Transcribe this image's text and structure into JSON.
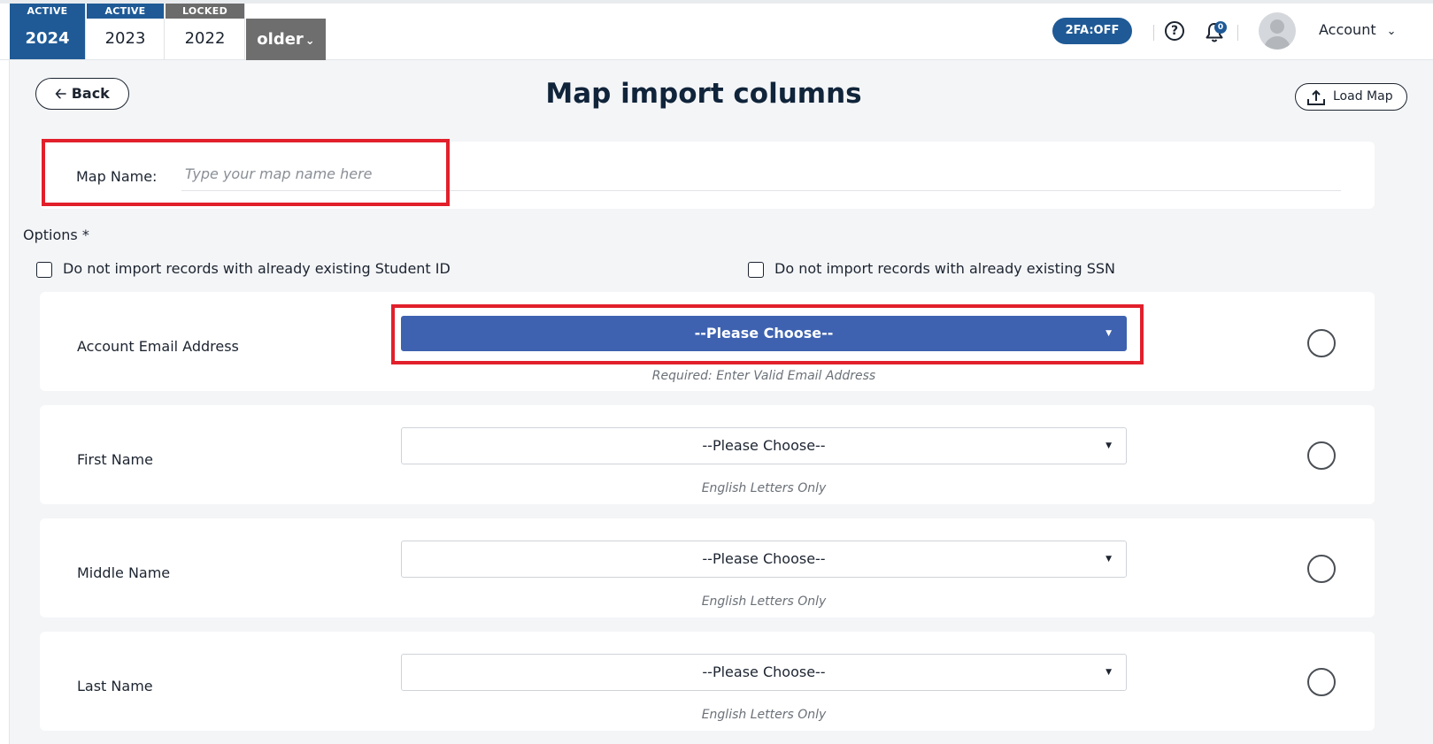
{
  "header": {
    "year_tabs": [
      {
        "status": "ACTIVE",
        "year": "2024"
      },
      {
        "status": "ACTIVE",
        "year": "2023"
      },
      {
        "status": "LOCKED",
        "year": "2022"
      }
    ],
    "older_label": "older",
    "twofa_label": "2FA:OFF",
    "notification_count": "0",
    "account_label": "Account"
  },
  "page": {
    "back_label": "Back",
    "title": "Map import columns",
    "load_map_label": "Load Map"
  },
  "map_name": {
    "label": "Map Name:",
    "placeholder": "Type your map name here",
    "value": ""
  },
  "options": {
    "label": "Options *",
    "checkboxes": [
      {
        "label": "Do not import records with already existing Student ID",
        "checked": false
      },
      {
        "label": "Do not import records with already existing SSN",
        "checked": false
      }
    ]
  },
  "columns": [
    {
      "label": "Account Email Address",
      "select_value": "--Please Choose--",
      "hint": "Required: Enter Valid Email Address"
    },
    {
      "label": "First Name",
      "select_value": "--Please Choose--",
      "hint": "English Letters Only"
    },
    {
      "label": "Middle Name",
      "select_value": "--Please Choose--",
      "hint": "English Letters Only"
    },
    {
      "label": "Last Name",
      "select_value": "--Please Choose--",
      "hint": "English Letters Only"
    }
  ],
  "colors": {
    "brand_blue": "#1f5a96",
    "select_primary": "#3e62b0",
    "highlight_red": "#e1202b"
  }
}
